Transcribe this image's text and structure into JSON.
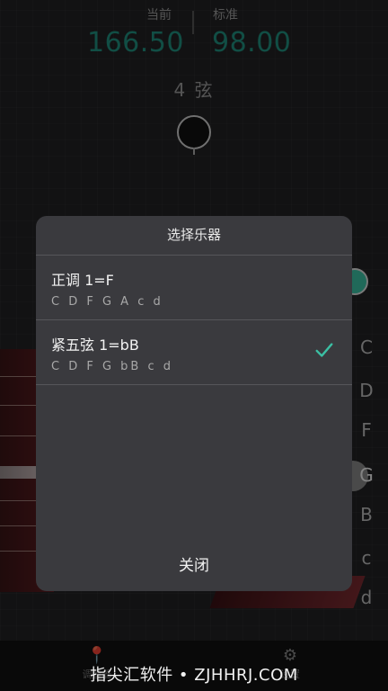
{
  "tuner": {
    "current_label": "当前",
    "current_value": "166.50",
    "standard_label": "标准",
    "standard_value": "98.00",
    "string_label": "4 弦",
    "notes": [
      "C",
      "D",
      "F",
      "G",
      "B",
      "c",
      "d"
    ]
  },
  "dialog": {
    "title": "选择乐器",
    "options": [
      {
        "name": "正调 1=F",
        "tuning": "C D F G A c d",
        "selected": false
      },
      {
        "name": "紧五弦 1=bB",
        "tuning": "C D F G bB c d",
        "selected": true
      }
    ],
    "close_label": "关闭"
  },
  "bottom_nav": {
    "tuner_label": "调音器",
    "settings_label": "设置"
  },
  "watermark": "指尖汇软件 • ZJHHRJ.COM",
  "colors": {
    "accent": "#3bbfa3",
    "reading": "#1f8f7e",
    "dialog_bg": "#3a3a3e"
  }
}
